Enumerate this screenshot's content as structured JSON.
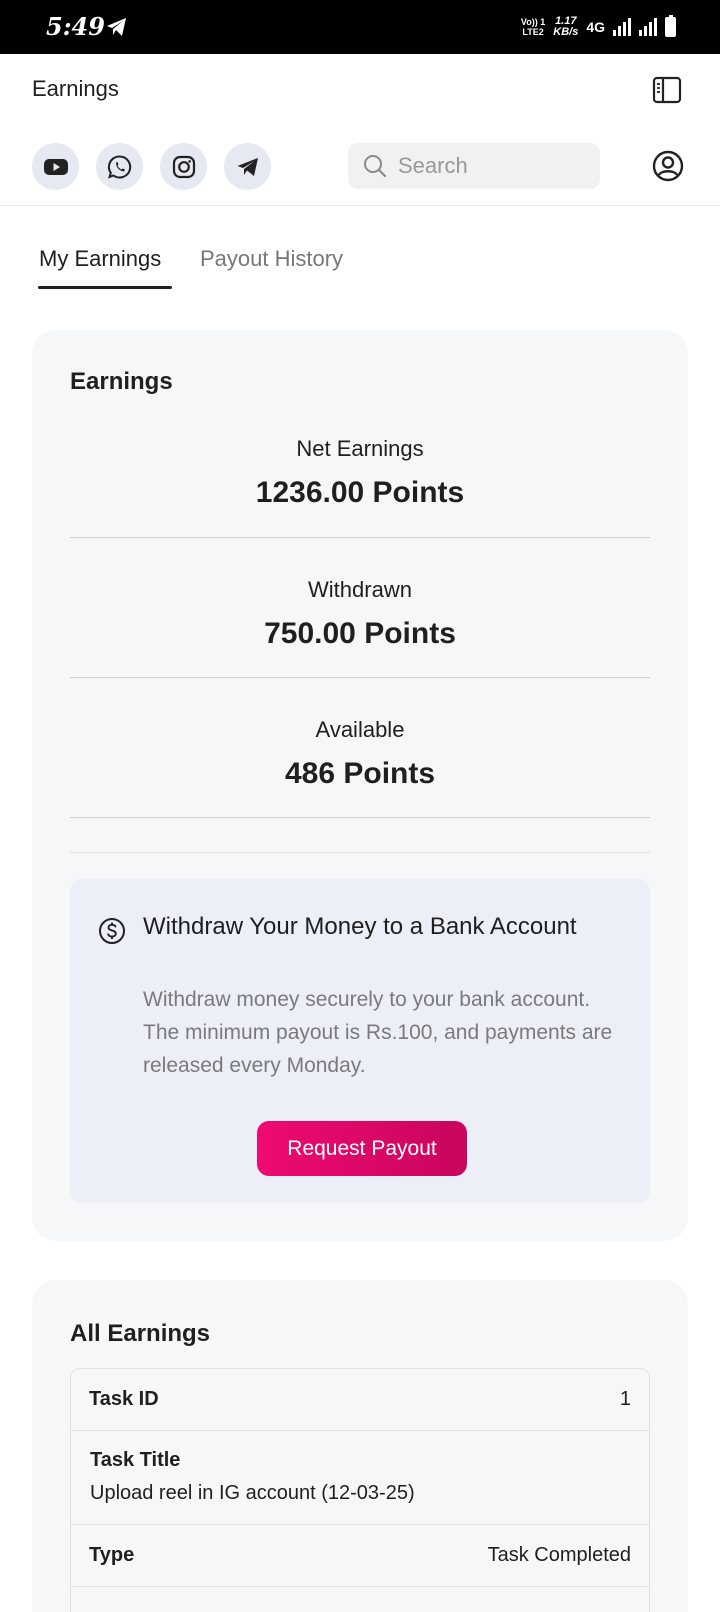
{
  "status_bar": {
    "time": "5:49",
    "network_top": "Vo)) 1",
    "network_bottom": "LTE2",
    "speed_value": "1.17",
    "speed_unit": "KB/s",
    "network_type": "4G"
  },
  "header": {
    "title": "Earnings",
    "search_placeholder": "Search",
    "social_icons": [
      "youtube-icon",
      "whatsapp-icon",
      "instagram-icon",
      "telegram-icon"
    ]
  },
  "tabs": [
    {
      "label": "My Earnings",
      "active": true
    },
    {
      "label": "Payout History",
      "active": false
    }
  ],
  "earnings_card": {
    "title": "Earnings",
    "stats": [
      {
        "label": "Net Earnings",
        "value": "1236.00 Points"
      },
      {
        "label": "Withdrawn",
        "value": "750.00 Points"
      },
      {
        "label": "Available",
        "value": "486 Points"
      }
    ],
    "withdraw": {
      "title": "Withdraw Your Money to a Bank Account",
      "description": "Withdraw money securely to your bank account. The minimum payout is Rs.100, and payments are released every Monday.",
      "button_label": "Request Payout"
    }
  },
  "all_earnings": {
    "title": "All Earnings",
    "rows": [
      {
        "key": "Task ID",
        "value": "1"
      },
      {
        "key": "Task Title",
        "value": "Upload reel in IG account (12-03-25)"
      },
      {
        "key": "Type",
        "value": "Task Completed"
      }
    ]
  },
  "colors": {
    "accent": "#e6096b",
    "card_bg": "#f6f7f9",
    "withdraw_bg": "#eceff7",
    "social_bg": "#e6e9f1"
  }
}
